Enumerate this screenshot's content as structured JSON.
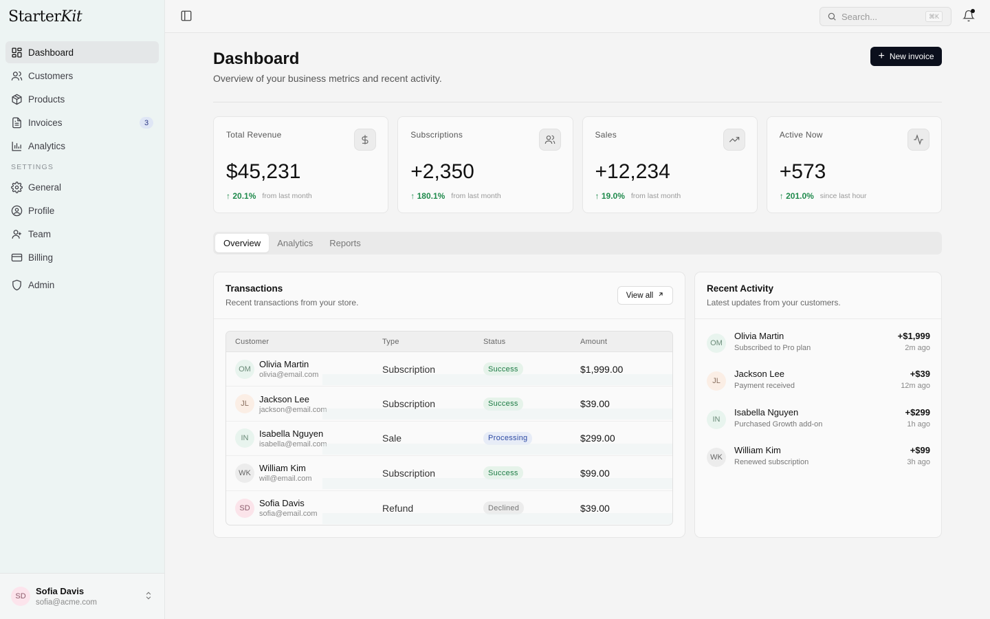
{
  "brand": {
    "name_plain": "Starter",
    "name_italic": "Kit"
  },
  "sidebar": {
    "items": [
      {
        "label": "Dashboard",
        "icon": "grid-icon",
        "active": true
      },
      {
        "label": "Customers",
        "icon": "users-icon"
      },
      {
        "label": "Products",
        "icon": "box-icon"
      },
      {
        "label": "Invoices",
        "icon": "file-icon",
        "badge": "3"
      },
      {
        "label": "Analytics",
        "icon": "bar-chart-icon"
      }
    ],
    "section_label": "SETTINGS",
    "settings_items": [
      {
        "label": "General",
        "icon": "gear-icon"
      },
      {
        "label": "Profile",
        "icon": "user-circle-icon"
      },
      {
        "label": "Team",
        "icon": "team-icon"
      },
      {
        "label": "Billing",
        "icon": "card-icon"
      }
    ],
    "admin_item": {
      "label": "Admin",
      "icon": "shield-icon"
    }
  },
  "user": {
    "initials": "SD",
    "name": "Sofia Davis",
    "email": "sofia@acme.com"
  },
  "topbar": {
    "search_placeholder": "Search...",
    "shortcut": "⌘K"
  },
  "page": {
    "title": "Dashboard",
    "subtitle": "Overview of your business metrics and recent activity.",
    "primary_action": "New invoice"
  },
  "stats": [
    {
      "label": "Total Revenue",
      "value": "$45,231",
      "change": "20.1%",
      "note": "from last month",
      "icon": "dollar-icon"
    },
    {
      "label": "Subscriptions",
      "value": "+2,350",
      "change": "180.1%",
      "note": "from last month",
      "icon": "users-icon"
    },
    {
      "label": "Sales",
      "value": "+12,234",
      "change": "19.0%",
      "note": "from last month",
      "icon": "trending-up-icon"
    },
    {
      "label": "Active Now",
      "value": "+573",
      "change": "201.0%",
      "note": "since last hour",
      "icon": "activity-icon"
    }
  ],
  "tabs": [
    {
      "label": "Overview",
      "active": true
    },
    {
      "label": "Analytics"
    },
    {
      "label": "Reports"
    }
  ],
  "transactions": {
    "title": "Transactions",
    "subtitle": "Recent transactions from your store.",
    "view_all": "View all",
    "columns": [
      "Customer",
      "Type",
      "Status",
      "Amount"
    ],
    "rows": [
      {
        "initials": "OM",
        "name": "Olivia Martin",
        "email": "olivia@email.com",
        "type": "Subscription",
        "status": "Success",
        "status_kind": "success",
        "amount": "$1,999.00"
      },
      {
        "initials": "JL",
        "name": "Jackson Lee",
        "email": "jackson@email.com",
        "type": "Subscription",
        "status": "Success",
        "status_kind": "success",
        "amount": "$39.00"
      },
      {
        "initials": "IN",
        "name": "Isabella Nguyen",
        "email": "isabella@email.com",
        "type": "Sale",
        "status": "Processing",
        "status_kind": "processing",
        "amount": "$299.00"
      },
      {
        "initials": "WK",
        "name": "William Kim",
        "email": "will@email.com",
        "type": "Subscription",
        "status": "Success",
        "status_kind": "success",
        "amount": "$99.00"
      },
      {
        "initials": "SD",
        "name": "Sofia Davis",
        "email": "sofia@email.com",
        "type": "Refund",
        "status": "Declined",
        "status_kind": "declined",
        "amount": "$39.00"
      }
    ]
  },
  "activity": {
    "title": "Recent Activity",
    "subtitle": "Latest updates from your customers.",
    "items": [
      {
        "initials": "OM",
        "name": "Olivia Martin",
        "desc": "Subscribed to Pro plan",
        "amount": "+$1,999",
        "time": "2m ago"
      },
      {
        "initials": "JL",
        "name": "Jackson Lee",
        "desc": "Payment received",
        "amount": "+$39",
        "time": "12m ago"
      },
      {
        "initials": "IN",
        "name": "Isabella Nguyen",
        "desc": "Purchased Growth add-on",
        "amount": "+$299",
        "time": "1h ago"
      },
      {
        "initials": "WK",
        "name": "William Kim",
        "desc": "Renewed subscription",
        "amount": "+$99",
        "time": "3h ago"
      }
    ]
  },
  "colors": {
    "accent": "#0b0f1c",
    "positive": "#1f8a4c",
    "sidebar_bg": "#edf4f3"
  }
}
